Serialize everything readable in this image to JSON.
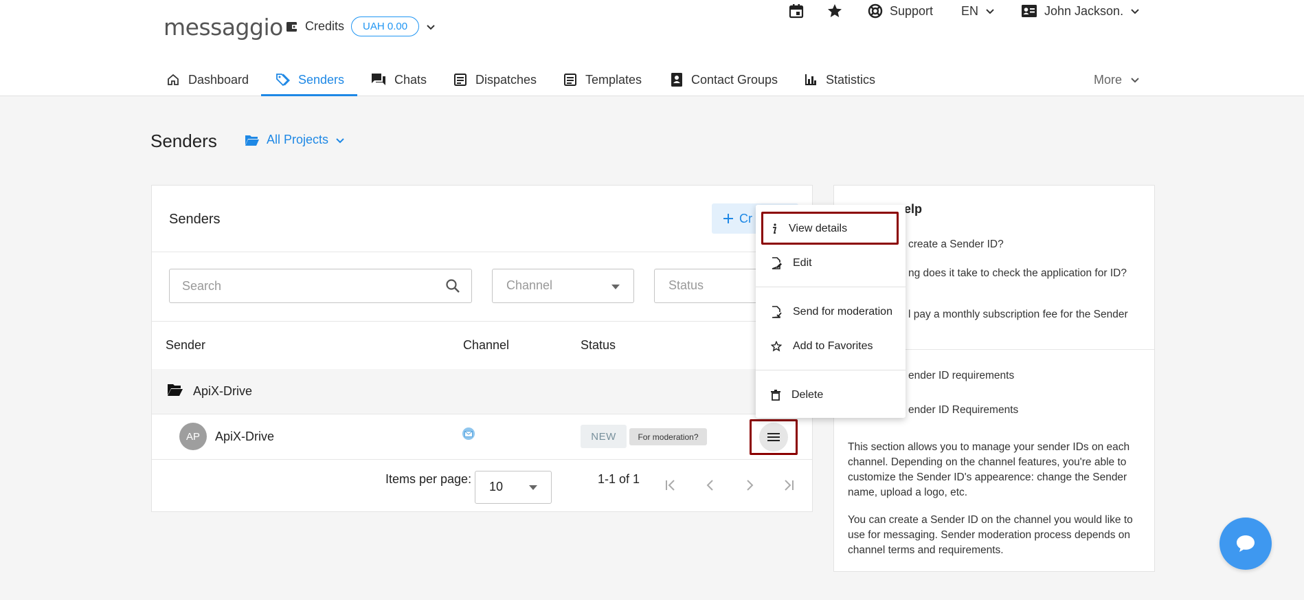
{
  "header": {
    "logo_text": "messaggio",
    "credits_label": "Credits",
    "credits_value": "UAH 0.00",
    "support_label": "Support",
    "language": "EN",
    "user_name": "John Jackson."
  },
  "nav": {
    "items": [
      {
        "label": "Dashboard"
      },
      {
        "label": "Senders"
      },
      {
        "label": "Chats"
      },
      {
        "label": "Dispatches"
      },
      {
        "label": "Templates"
      },
      {
        "label": "Contact Groups"
      },
      {
        "label": "Statistics"
      }
    ],
    "more_label": "More"
  },
  "page": {
    "title": "Senders",
    "projects_label": "All Projects"
  },
  "senders_card": {
    "title": "Senders",
    "create_label": "Cr",
    "search_placeholder": "Search",
    "channel_placeholder": "Channel",
    "status_placeholder": "Status",
    "columns": [
      "Sender",
      "Channel",
      "Status"
    ],
    "group_name": "ApiX-Drive",
    "row": {
      "avatar_initials": "AP",
      "name": "ApiX-Drive",
      "status_badge": "NEW",
      "moderation_badge": "For moderation?"
    },
    "pagination": {
      "items_per_page_label": "Items per page:",
      "items_per_page_value": "10",
      "range": "1-1 of 1"
    }
  },
  "help_card": {
    "title": "elp",
    "questions": [
      "create a Sender ID?",
      "ng does it take to check the application for ID?",
      "l pay a monthly subscription fee for the Sender"
    ],
    "links": [
      "ender ID requirements",
      "ender ID Requirements"
    ],
    "description_1": "This section allows you to manage your sender IDs on each channel. Depending on the channel features, you're able to customize the Sender ID's appearence: change the Sender name, upload a logo, etc.",
    "description_2": "You can create a Sender ID on the channel you would like to use for messaging. Sender moderation process depends on channel terms and requirements."
  },
  "context_menu": {
    "items": [
      {
        "label": "View details"
      },
      {
        "label": "Edit"
      },
      {
        "label": "Send for moderation"
      },
      {
        "label": "Add to Favorites"
      },
      {
        "label": "Delete"
      }
    ]
  },
  "colors": {
    "accent": "#1e88e5",
    "highlight": "#8b0000",
    "fab": "#3e98f0"
  }
}
